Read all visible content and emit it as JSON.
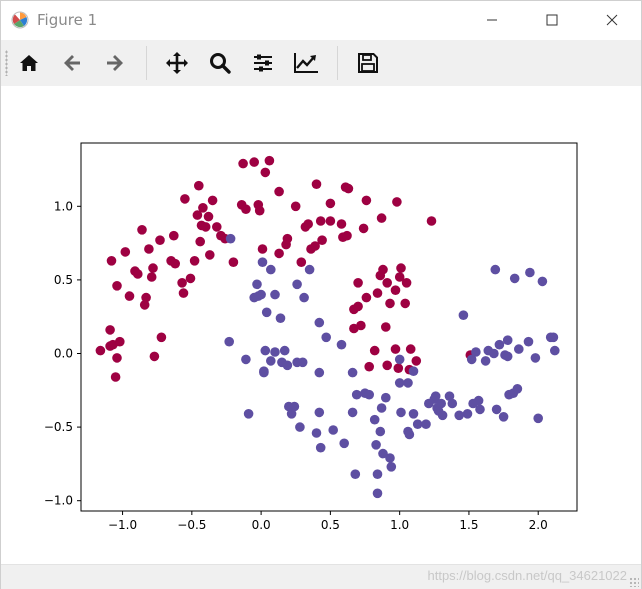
{
  "window": {
    "title": "Figure 1"
  },
  "toolbar": {
    "buttons": [
      {
        "name": "home",
        "icon": "home-icon"
      },
      {
        "name": "back",
        "icon": "arrow-left-icon"
      },
      {
        "name": "forward",
        "icon": "arrow-right-icon"
      },
      {
        "name": "pan",
        "icon": "move-icon"
      },
      {
        "name": "zoom",
        "icon": "magnifier-icon"
      },
      {
        "name": "configure-subplots",
        "icon": "sliders-icon"
      },
      {
        "name": "edit-axes",
        "icon": "line-chart-icon"
      },
      {
        "name": "save",
        "icon": "floppy-disk-icon"
      }
    ]
  },
  "status": {
    "watermark": "https://blog.csdn.net/qq_34621022"
  },
  "chart_data": {
    "type": "scatter",
    "title": "",
    "xlabel": "",
    "ylabel": "",
    "xlim": [
      -1.3,
      2.28
    ],
    "ylim": [
      -1.07,
      1.43
    ],
    "xticks": [
      -1.0,
      -0.5,
      0.0,
      0.5,
      1.0,
      1.5,
      2.0
    ],
    "xtick_labels": [
      "−1.0",
      "−0.5",
      "0.0",
      "0.5",
      "1.0",
      "1.5",
      "2.0"
    ],
    "yticks": [
      -1.0,
      -0.5,
      0.0,
      0.5,
      1.0
    ],
    "ytick_labels": [
      "−1.0",
      "−0.5",
      "0.0",
      "0.5",
      "1.0"
    ],
    "grid": false,
    "colors": [
      "#9e0142",
      "#5e4fa2"
    ],
    "series": [
      {
        "color": "#9e0142",
        "points": [
          [
            -1.16,
            0.02
          ],
          [
            -1.09,
            0.16
          ],
          [
            -1.09,
            0.05
          ],
          [
            -1.07,
            0.06
          ],
          [
            -1.05,
            -0.16
          ],
          [
            -1.04,
            -0.03
          ],
          [
            -1.02,
            0.08
          ],
          [
            -1.08,
            0.63
          ],
          [
            -1.04,
            0.46
          ],
          [
            -0.98,
            0.69
          ],
          [
            -0.95,
            0.39
          ],
          [
            -0.91,
            0.56
          ],
          [
            -0.89,
            0.54
          ],
          [
            -0.86,
            0.84
          ],
          [
            -0.84,
            0.33
          ],
          [
            -0.83,
            0.38
          ],
          [
            -0.81,
            0.71
          ],
          [
            -0.79,
            0.52
          ],
          [
            -0.78,
            0.58
          ],
          [
            -0.77,
            -0.02
          ],
          [
            -0.72,
            0.11
          ],
          [
            -0.73,
            0.77
          ],
          [
            -0.65,
            0.63
          ],
          [
            -0.63,
            0.8
          ],
          [
            -0.62,
            0.61
          ],
          [
            -0.57,
            0.48
          ],
          [
            -0.56,
            0.41
          ],
          [
            -0.55,
            1.05
          ],
          [
            -0.51,
            0.51
          ],
          [
            -0.48,
            0.63
          ],
          [
            -0.46,
            0.94
          ],
          [
            -0.45,
            1.14
          ],
          [
            -0.44,
            0.76
          ],
          [
            -0.43,
            0.87
          ],
          [
            -0.42,
            0.99
          ],
          [
            -0.4,
            0.86
          ],
          [
            -0.38,
            0.93
          ],
          [
            -0.37,
            0.67
          ],
          [
            -0.35,
            1.04
          ],
          [
            -0.32,
            0.86
          ],
          [
            -0.29,
            0.8
          ],
          [
            -0.26,
            0.78
          ],
          [
            -0.2,
            0.62
          ],
          [
            -0.14,
            1.01
          ],
          [
            -0.13,
            1.29
          ],
          [
            -0.11,
            0.98
          ],
          [
            -0.05,
            1.3
          ],
          [
            -0.02,
            1.01
          ],
          [
            -0.01,
            0.97
          ],
          [
            0.01,
            0.71
          ],
          [
            0.03,
            1.23
          ],
          [
            0.06,
            1.31
          ],
          [
            0.13,
            0.68
          ],
          [
            0.13,
            1.1
          ],
          [
            0.18,
            0.74
          ],
          [
            0.19,
            0.78
          ],
          [
            0.25,
            1.0
          ],
          [
            0.29,
            0.62
          ],
          [
            0.32,
            0.86
          ],
          [
            0.34,
            0.88
          ],
          [
            0.36,
            0.71
          ],
          [
            0.39,
            0.73
          ],
          [
            0.4,
            1.15
          ],
          [
            0.43,
            0.9
          ],
          [
            0.44,
            0.77
          ],
          [
            0.5,
            0.9
          ],
          [
            0.5,
            1.02
          ],
          [
            0.58,
            0.88
          ],
          [
            0.59,
            0.79
          ],
          [
            0.61,
            1.13
          ],
          [
            0.63,
            1.12
          ],
          [
            0.62,
            0.8
          ],
          [
            0.67,
            0.3
          ],
          [
            0.67,
            0.17
          ],
          [
            0.7,
            0.32
          ],
          [
            0.7,
            0.48
          ],
          [
            0.72,
            0.19
          ],
          [
            0.76,
            0.38
          ],
          [
            0.74,
            0.85
          ],
          [
            0.76,
            1.04
          ],
          [
            0.78,
            -0.09
          ],
          [
            0.82,
            0.02
          ],
          [
            0.84,
            0.41
          ],
          [
            0.86,
            0.53
          ],
          [
            0.87,
            0.92
          ],
          [
            0.88,
            0.57
          ],
          [
            0.9,
            0.18
          ],
          [
            0.91,
            0.48
          ],
          [
            0.91,
            -0.08
          ],
          [
            0.93,
            0.34
          ],
          [
            0.97,
            0.03
          ],
          [
            0.97,
            0.43
          ],
          [
            0.98,
            1.03
          ],
          [
            0.99,
            -0.1
          ],
          [
            1.0,
            0.52
          ],
          [
            1.01,
            0.58
          ],
          [
            1.04,
            0.34
          ],
          [
            1.05,
            0.48
          ],
          [
            1.07,
            -0.11
          ],
          [
            1.08,
            0.03
          ],
          [
            1.12,
            -0.05
          ],
          [
            1.23,
            0.9
          ],
          [
            1.51,
            -0.01
          ]
        ]
      },
      {
        "color": "#5e4fa2",
        "points": [
          [
            -0.22,
            0.78
          ],
          [
            -0.23,
            0.08
          ],
          [
            -0.11,
            -0.04
          ],
          [
            -0.09,
            -0.41
          ],
          [
            -0.05,
            0.38
          ],
          [
            -0.03,
            0.47
          ],
          [
            -0.02,
            0.39
          ],
          [
            0.0,
            0.4
          ],
          [
            0.01,
            0.62
          ],
          [
            0.02,
            -0.12
          ],
          [
            0.02,
            -0.13
          ],
          [
            0.03,
            0.02
          ],
          [
            0.04,
            0.28
          ],
          [
            0.07,
            0.57
          ],
          [
            0.07,
            -0.05
          ],
          [
            0.1,
            0.4
          ],
          [
            0.1,
            0.01
          ],
          [
            0.14,
            0.24
          ],
          [
            0.15,
            -0.06
          ],
          [
            0.17,
            0.02
          ],
          [
            0.19,
            -0.08
          ],
          [
            0.2,
            -0.36
          ],
          [
            0.22,
            -0.41
          ],
          [
            0.24,
            -0.36
          ],
          [
            0.26,
            -0.06
          ],
          [
            0.26,
            0.47
          ],
          [
            0.28,
            -0.5
          ],
          [
            0.3,
            -0.06
          ],
          [
            0.31,
            0.38
          ],
          [
            0.35,
            0.57
          ],
          [
            0.4,
            -0.54
          ],
          [
            0.42,
            -0.4
          ],
          [
            0.42,
            0.21
          ],
          [
            0.42,
            -0.13
          ],
          [
            0.43,
            -0.64
          ],
          [
            0.47,
            0.11
          ],
          [
            0.52,
            -0.52
          ],
          [
            0.58,
            0.06
          ],
          [
            0.6,
            -0.61
          ],
          [
            0.66,
            -0.13
          ],
          [
            0.66,
            -0.4
          ],
          [
            0.68,
            -0.82
          ],
          [
            0.69,
            -0.28
          ],
          [
            0.75,
            -0.27
          ],
          [
            0.78,
            -0.28
          ],
          [
            0.82,
            -0.45
          ],
          [
            0.83,
            -0.62
          ],
          [
            0.84,
            -0.82
          ],
          [
            0.84,
            -0.95
          ],
          [
            0.86,
            -0.53
          ],
          [
            0.87,
            -0.37
          ],
          [
            0.88,
            -0.68
          ],
          [
            0.9,
            -0.3
          ],
          [
            0.93,
            -0.71
          ],
          [
            0.94,
            -0.77
          ],
          [
            1.0,
            -0.04
          ],
          [
            1.0,
            -0.2
          ],
          [
            1.01,
            -0.4
          ],
          [
            1.06,
            -0.53
          ],
          [
            1.06,
            -0.2
          ],
          [
            1.07,
            -0.55
          ],
          [
            1.1,
            -0.12
          ],
          [
            1.1,
            -0.41
          ],
          [
            1.13,
            -0.48
          ],
          [
            1.19,
            -0.48
          ],
          [
            1.21,
            -0.34
          ],
          [
            1.25,
            -0.31
          ],
          [
            1.26,
            -0.29
          ],
          [
            1.27,
            -0.37
          ],
          [
            1.28,
            -0.39
          ],
          [
            1.3,
            -0.34
          ],
          [
            1.31,
            -0.42
          ],
          [
            1.36,
            -0.29
          ],
          [
            1.38,
            -0.34
          ],
          [
            1.43,
            -0.42
          ],
          [
            1.46,
            0.26
          ],
          [
            1.49,
            -0.41
          ],
          [
            1.52,
            -0.04
          ],
          [
            1.53,
            -0.34
          ],
          [
            1.55,
            0.01
          ],
          [
            1.57,
            -0.32
          ],
          [
            1.58,
            -0.38
          ],
          [
            1.62,
            -0.05
          ],
          [
            1.64,
            0.02
          ],
          [
            1.68,
            0.0
          ],
          [
            1.69,
            0.57
          ],
          [
            1.7,
            -0.38
          ],
          [
            1.72,
            0.06
          ],
          [
            1.75,
            -0.43
          ],
          [
            1.76,
            -0.01
          ],
          [
            1.78,
            0.09
          ],
          [
            1.78,
            -0.02
          ],
          [
            1.79,
            -0.28
          ],
          [
            1.82,
            -0.27
          ],
          [
            1.83,
            0.51
          ],
          [
            1.85,
            -0.24
          ],
          [
            1.86,
            0.03
          ],
          [
            1.93,
            0.08
          ],
          [
            1.94,
            0.55
          ],
          [
            1.98,
            -0.03
          ],
          [
            2.0,
            -0.44
          ],
          [
            2.03,
            0.49
          ],
          [
            2.09,
            0.11
          ],
          [
            2.11,
            0.11
          ],
          [
            2.12,
            0.02
          ]
        ]
      }
    ]
  }
}
